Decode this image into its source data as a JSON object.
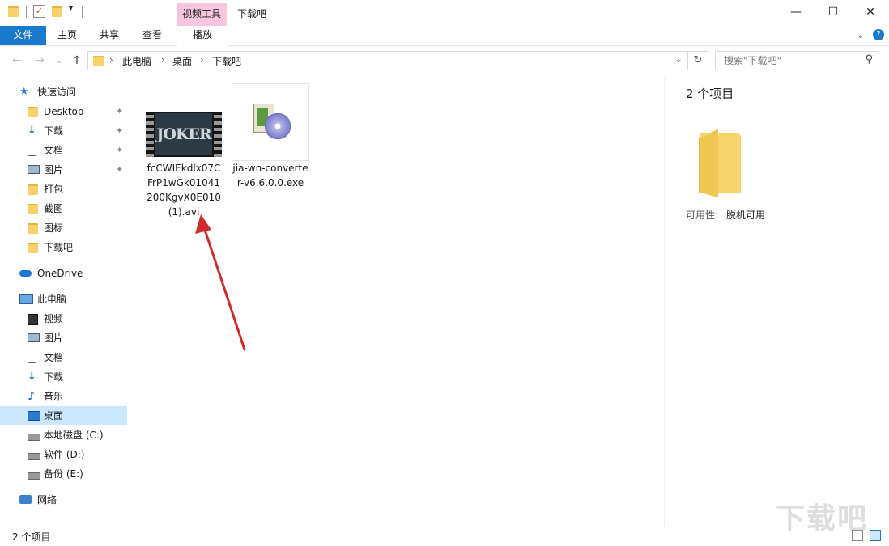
{
  "titlebar": {
    "context_tab": "视频工具",
    "title": "下载吧",
    "minimize_glyph": "—",
    "maximize_glyph": "☐",
    "close_glyph": "✕"
  },
  "ribbon": {
    "file": "文件",
    "home": "主页",
    "share": "共享",
    "view": "查看",
    "play": "播放",
    "collapse_glyph": "⌄",
    "help_glyph": "?"
  },
  "address": {
    "back_glyph": "←",
    "forward_glyph": "→",
    "recent_glyph": "⌄",
    "up_glyph": "↑",
    "sep": "›",
    "crumbs": [
      "此电脑",
      "桌面",
      "下载吧"
    ],
    "dropdown_glyph": "⌄",
    "refresh_glyph": "↻",
    "search_placeholder": "搜索\"下载吧\"",
    "search_glyph": "⚲"
  },
  "sidebar": {
    "quick_access": "快速访问",
    "quick_items": [
      "Desktop",
      "下载",
      "文档",
      "图片",
      "打包",
      "截图",
      "图标",
      "下载吧"
    ],
    "pin_glyph": "✦",
    "onedrive": "OneDrive",
    "this_pc": "此电脑",
    "pc_items": [
      "视频",
      "图片",
      "文档",
      "下载",
      "音乐",
      "桌面",
      "本地磁盘 (C:)",
      "软件 (D:)",
      "备份 (E:)"
    ],
    "network": "网络"
  },
  "files": [
    {
      "name": "fcCWIEkdlx07CFrP1wGk01041200KgvX0E010(1).avi",
      "icon": "video-thumbnail-icon",
      "thumb_text": "JOKER"
    },
    {
      "name": "jia-wn-converter-v6.6.0.0.exe",
      "icon": "installer-icon"
    }
  ],
  "details": {
    "count": "2 个项目",
    "availability_label": "可用性:",
    "availability_value": "脱机可用"
  },
  "status": {
    "count": "2 个项目"
  },
  "watermark": "下载吧",
  "colors": {
    "accent": "#1979ca",
    "context_tab": "#f7c5de",
    "selection": "#cce8ff",
    "arrow": "#d22a2a",
    "folder": "#f7d26b"
  }
}
